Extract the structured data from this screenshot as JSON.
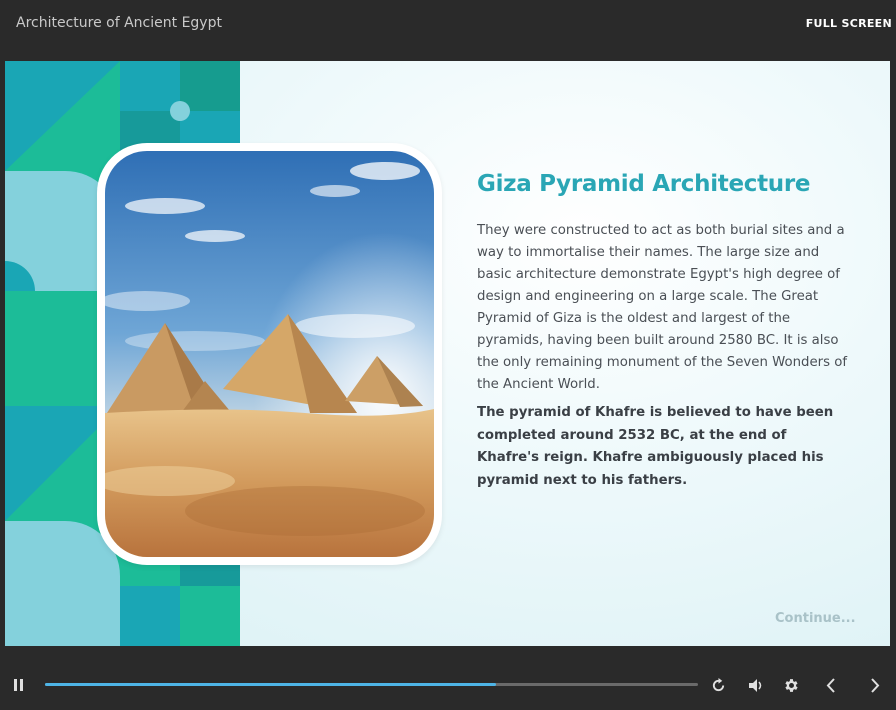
{
  "header": {
    "course_title": "Architecture of Ancient Egypt",
    "fullscreen_label": "FULL SCREEN"
  },
  "slide": {
    "heading": "Giza Pyramid Architecture",
    "paragraph": "They were constructed to act as both burial sites and a way to immortalise their names. The large size and basic architecture demonstrate Egypt's high degree of design and engineering on a large scale. The Great Pyramid of Giza is the oldest and largest of the pyramids, having been built around 2580 BC. It is also the only remaining monument of the Seven Wonders of the Ancient World.",
    "bold_paragraph": "The pyramid of Khafre is believed to have been completed around 2532 BC, at the end of Khafre's reign. Khafre ambiguously placed his pyramid next to his fathers.",
    "continue_label": "Continue..."
  },
  "playbar": {
    "progress": 0.69,
    "icons": [
      "pause-icon",
      "replay-icon",
      "volume-icon",
      "gear-icon",
      "chevron-left-icon",
      "chevron-right-icon"
    ]
  },
  "colors": {
    "accent": "#2aa6b5",
    "progress": "#4eb4e6",
    "mosaic_teal": "#1aa6b5",
    "mosaic_green": "#1cbc98",
    "mosaic_light": "#84d1dc"
  }
}
